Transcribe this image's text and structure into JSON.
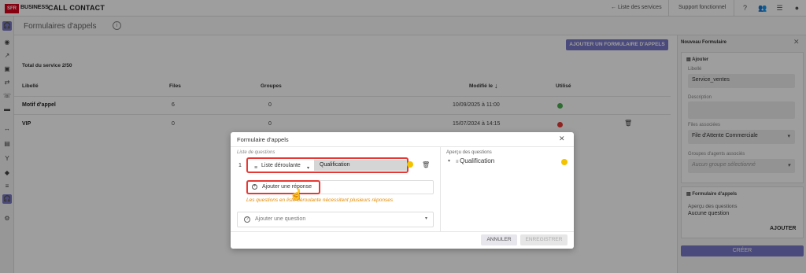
{
  "header": {
    "logo": "SFR",
    "brand": "BUSINESS",
    "app_name": "CALL CONTACT",
    "services_link": "← Liste des services",
    "support_link": "Support fonctionnel"
  },
  "page": {
    "title": "Formulaires d'appels",
    "add_button": "AJOUTER UN FORMULAIRE D'APPELS",
    "total": "Total du service 2/50",
    "columns": [
      "Libellé",
      "Files",
      "Groupes",
      "Modifié le",
      "Utilisé"
    ],
    "rows": [
      {
        "label": "Motif d'appel",
        "files": "6",
        "groups": "0",
        "modified": "10/09/2025 à 11:00",
        "used_color": "#4caf50"
      },
      {
        "label": "VIP",
        "files": "0",
        "groups": "0",
        "modified": "15/07/2024 à 14:15",
        "used_color": "#e53935"
      }
    ]
  },
  "right_panel": {
    "title": "Nouveau Formulaire",
    "add_section": "Ajouter",
    "libelle_label": "Libellé",
    "libelle_value": "Service_ventes",
    "description_label": "Description",
    "files_label": "Files associées",
    "files_value": "File d'Attente Commerciale",
    "groups_label": "Groupes d'agents associés",
    "groups_placeholder": "Aucun groupe sélectionné",
    "form_section": "Formulaire d'appels",
    "preview_label": "Aperçu des questions",
    "preview_value": "Aucune question",
    "add_link": "AJOUTER",
    "create_button": "CRÉER"
  },
  "modal": {
    "title": "Formulaire d'appels",
    "questions_label": "Liste de questions",
    "preview_label": "Aperçu des questions",
    "question_number": "1",
    "question_type": "Liste déroulante",
    "question_text": "Qualification",
    "add_answer": "Ajouter une réponse",
    "warning": "Les questions en liste déroulante nécessitent plusieurs réponses",
    "add_question": "Ajouter une question",
    "preview_item": "Qualification",
    "cancel": "ANNULER",
    "save": "ENREGISTRER"
  }
}
